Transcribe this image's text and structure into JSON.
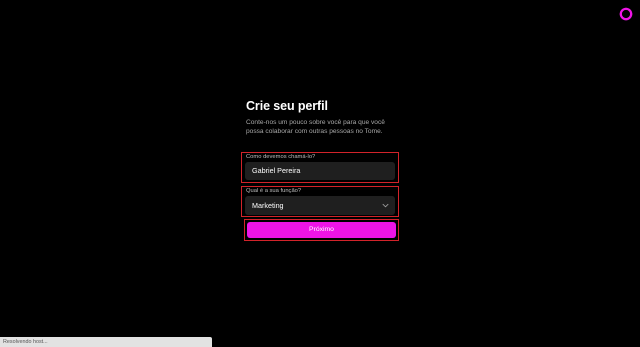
{
  "app": {
    "logo_icon": "tome-ring-logo-icon",
    "accent_color": "#ee14e6"
  },
  "form": {
    "title": "Crie seu perfil",
    "subtitle": "Conte-nos um pouco sobre você para que você possa colaborar com outras pessoas no Tome.",
    "name_field": {
      "label": "Como devemos chamá-lo?",
      "value": "Gabriel Pereira"
    },
    "role_field": {
      "label": "Qual é a sua função?",
      "value": "Marketing",
      "icon": "chevron-down-icon"
    },
    "next_button": {
      "label": "Próximo"
    }
  },
  "browser": {
    "status_text": "Resolvendo host..."
  }
}
